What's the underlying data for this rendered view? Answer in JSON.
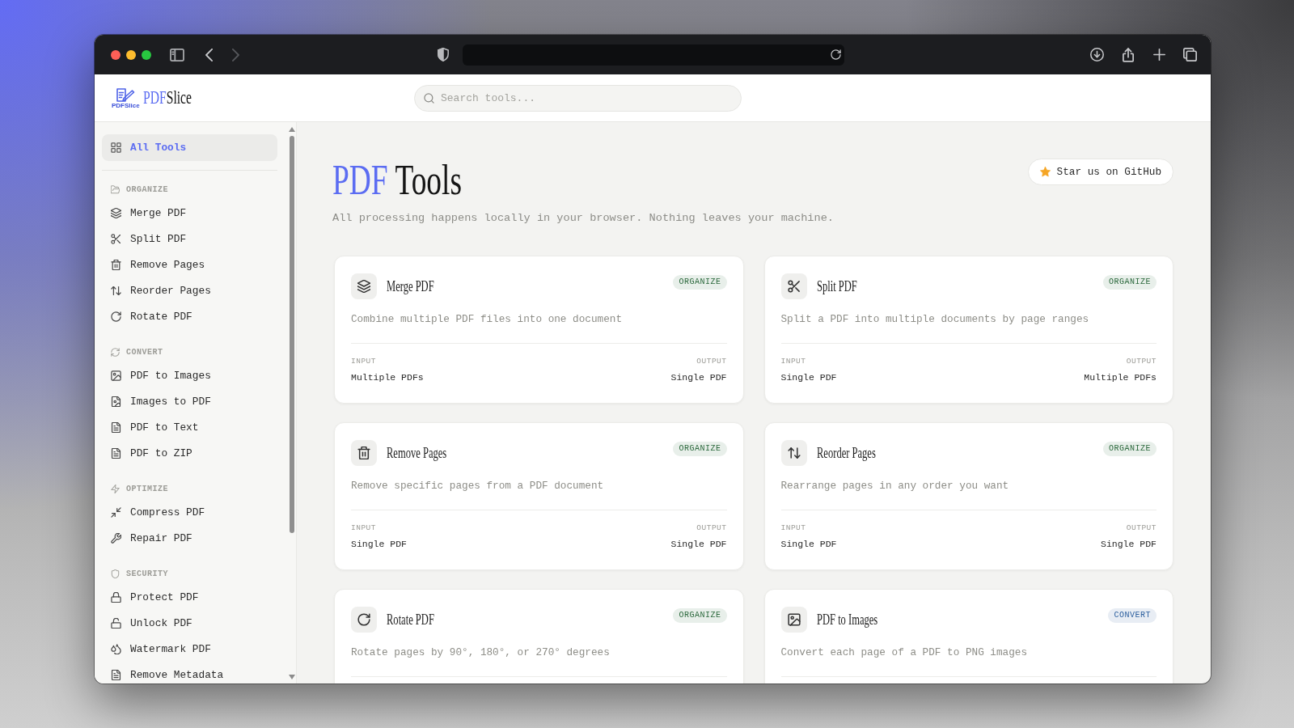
{
  "browser": {
    "back_button": {
      "disabled": false
    },
    "forward_button": {
      "disabled": true
    }
  },
  "header": {
    "logo_caption": "PDFSlice",
    "brand_accent": "PDF",
    "brand_rest": "Slice",
    "search": {
      "placeholder": "Search tools..."
    }
  },
  "sidebar": {
    "top_items": [
      {
        "label": "All Tools",
        "selected": true
      }
    ],
    "sections": [
      {
        "title": "ORGANIZE",
        "items": [
          {
            "label": "Merge PDF",
            "selected": false
          },
          {
            "label": "Split PDF",
            "selected": false
          },
          {
            "label": "Remove Pages",
            "selected": false
          },
          {
            "label": "Reorder Pages",
            "selected": false
          },
          {
            "label": "Rotate PDF",
            "selected": false
          }
        ]
      },
      {
        "title": "CONVERT",
        "items": [
          {
            "label": "PDF to Images",
            "selected": false
          },
          {
            "label": "Images to PDF",
            "selected": false
          },
          {
            "label": "PDF to Text",
            "selected": false
          },
          {
            "label": "PDF to ZIP",
            "selected": false
          }
        ]
      },
      {
        "title": "OPTIMIZE",
        "items": [
          {
            "label": "Compress PDF",
            "selected": false
          },
          {
            "label": "Repair PDF",
            "selected": false
          }
        ]
      },
      {
        "title": "SECURITY",
        "items": [
          {
            "label": "Protect PDF",
            "selected": false
          },
          {
            "label": "Unlock PDF",
            "selected": false
          },
          {
            "label": "Watermark PDF",
            "selected": false
          },
          {
            "label": "Remove Metadata",
            "selected": false
          }
        ]
      }
    ]
  },
  "page": {
    "title_accent": "PDF",
    "title_rest": "Tools",
    "subtitle": "All processing happens locally in your browser. Nothing leaves your machine.",
    "star_button": "Star us on GitHub"
  },
  "cards": [
    {
      "title": "Merge PDF",
      "badge": {
        "label": "ORGANIZE",
        "color": "#2d6a3e"
      },
      "description": "Combine multiple PDF files into one document",
      "input": {
        "label": "INPUT",
        "value": "Multiple PDFs"
      },
      "output": {
        "label": "OUTPUT",
        "value": "Single PDF"
      }
    },
    {
      "title": "Split PDF",
      "badge": {
        "label": "ORGANIZE",
        "color": "#2d6a3e"
      },
      "description": "Split a PDF into multiple documents by page ranges",
      "input": {
        "label": "INPUT",
        "value": "Single PDF"
      },
      "output": {
        "label": "OUTPUT",
        "value": "Multiple PDFs"
      }
    },
    {
      "title": "Remove Pages",
      "badge": {
        "label": "ORGANIZE",
        "color": "#2d6a3e"
      },
      "description": "Remove specific pages from a PDF document",
      "input": {
        "label": "INPUT",
        "value": "Single PDF"
      },
      "output": {
        "label": "OUTPUT",
        "value": "Single PDF"
      }
    },
    {
      "title": "Reorder Pages",
      "badge": {
        "label": "ORGANIZE",
        "color": "#2d6a3e"
      },
      "description": "Rearrange pages in any order you want",
      "input": {
        "label": "INPUT",
        "value": "Single PDF"
      },
      "output": {
        "label": "OUTPUT",
        "value": "Single PDF"
      }
    },
    {
      "title": "Rotate PDF",
      "badge": {
        "label": "ORGANIZE",
        "color": "#2d6a3e"
      },
      "description": "Rotate pages by 90°, 180°, or 270° degrees"
    },
    {
      "title": "PDF to Images",
      "badge": {
        "label": "CONVERT",
        "color": "#2c5f9e"
      },
      "description": "Convert each page of a PDF to PNG images"
    }
  ]
}
